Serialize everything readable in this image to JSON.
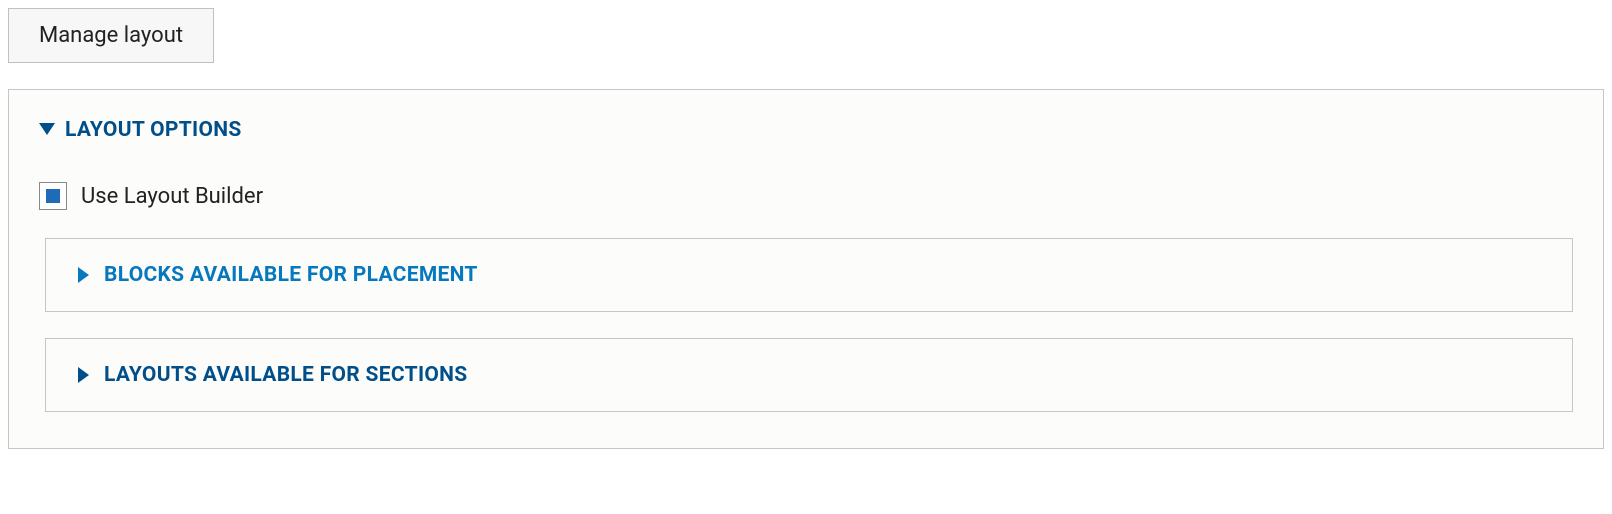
{
  "tab": {
    "manage_layout_label": "Manage layout"
  },
  "layout_options": {
    "title": "LAYOUT OPTIONS",
    "expanded": true,
    "use_layout_builder": {
      "label": "Use Layout Builder",
      "checked": true
    },
    "blocks_available": {
      "title": "BLOCKS AVAILABLE FOR PLACEMENT",
      "expanded": false
    },
    "layouts_available": {
      "title": "LAYOUTS AVAILABLE FOR SECTIONS",
      "expanded": false
    }
  },
  "colors": {
    "primary_dark": "#004f8a",
    "primary_light": "#0678be",
    "checkbox_fill": "#1e6bb8",
    "border": "#c6c6c6"
  }
}
